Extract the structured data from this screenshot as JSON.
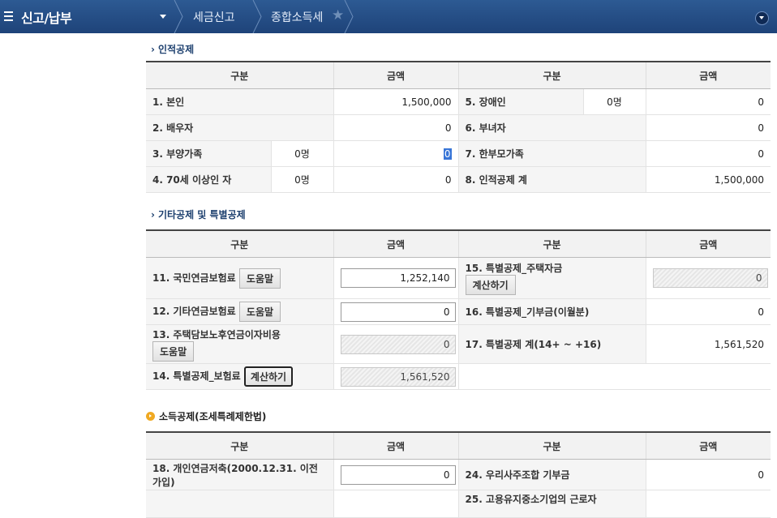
{
  "header": {
    "title": "신고/납부",
    "breadcrumb": [
      "세금신고",
      "종합소득세"
    ]
  },
  "sections": {
    "s1": "인적공제",
    "s2": "기타공제 및 특별공제",
    "s3": "소득공제(조세특례제한법)"
  },
  "cols": {
    "gubun": "구분",
    "amount": "금액"
  },
  "personal": {
    "r1_label": "1. 본인",
    "r1_amount": "1,500,000",
    "r5_label": "5. 장애인",
    "r5_count": "0명",
    "r5_amount": "0",
    "r2_label": "2. 배우자",
    "r2_amount": "0",
    "r6_label": "6. 부녀자",
    "r6_amount": "0",
    "r3_label": "3. 부양가족",
    "r3_count": "0명",
    "r3_amount": "0",
    "r7_label": "7. 한부모가족",
    "r7_amount": "0",
    "r4_label": "4. 70세 이상인 자",
    "r4_count": "0명",
    "r4_amount": "0",
    "r8_label": "8. 인적공제 계",
    "r8_amount": "1,500,000"
  },
  "special": {
    "r11_label": "11. 국민연금보험료",
    "r11_amount": "1,252,140",
    "r15_label": "15. 특별공제_주택자금",
    "r15_amount": "0",
    "r12_label": "12. 기타연금보험료",
    "r12_amount": "0",
    "r16_label": "16. 특별공제_기부금(이월분)",
    "r16_amount": "0",
    "r13_label": "13. 주택담보노후연금이자비용",
    "r13_amount": "0",
    "r17_label": "17. 특별공제 계(14+ ~ +16)",
    "r17_amount": "1,561,520",
    "r14_label": "14. 특별공제_보험료",
    "r14_amount": "1,561,520"
  },
  "buttons": {
    "help": "도움말",
    "calc": "계산하기"
  },
  "tax": {
    "r18_label_1": "18. 개인연금저축(2000.12.31. 이전",
    "r18_label_2": "가입)",
    "r18_amount": "0",
    "r24_label": "24. 우리사주조합 기부금",
    "r24_amount": "0",
    "r25_label_partial": "25. 고용유지중소기업의 근로자"
  }
}
